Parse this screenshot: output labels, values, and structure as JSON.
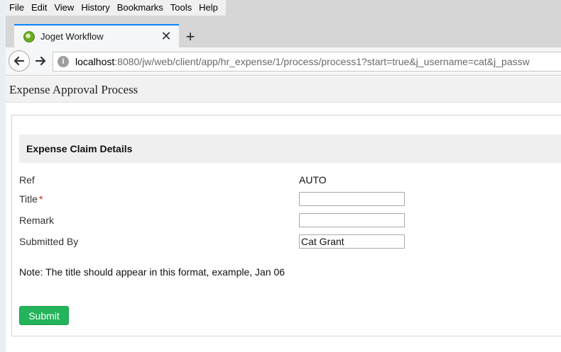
{
  "menu": {
    "file": "File",
    "edit": "Edit",
    "view": "View",
    "history": "History",
    "bookmarks": "Bookmarks",
    "tools": "Tools",
    "help": "Help"
  },
  "tab": {
    "title": "Joget Workflow",
    "close_glyph": "✕",
    "new_tab_glyph": "+"
  },
  "nav": {
    "back_glyph": "🡐",
    "forward_glyph": "➜",
    "url_host": "localhost",
    "url_rest": ":8080/jw/web/client/app/hr_expense/1/process/process1?start=true&j_username=cat&j_passw"
  },
  "page": {
    "title": "Expense Approval Process"
  },
  "form": {
    "section_title": "Expense Claim Details",
    "ref_label": "Ref",
    "ref_value": "AUTO",
    "title_label": "Title",
    "required_mark": "*",
    "title_value": "",
    "remark_label": "Remark",
    "remark_value": "",
    "submitted_by_label": "Submitted By",
    "submitted_by_value": "Cat Grant",
    "note": "Note: The title should appear in this format, example, Jan 06",
    "submit_label": "Submit"
  },
  "colors": {
    "accent_tab": "#0a84ff",
    "submit_green": "#23b35a",
    "required_red": "#e02020"
  },
  "icons": {
    "tab_favicon": "joget-icon",
    "info": "site-info-icon"
  }
}
